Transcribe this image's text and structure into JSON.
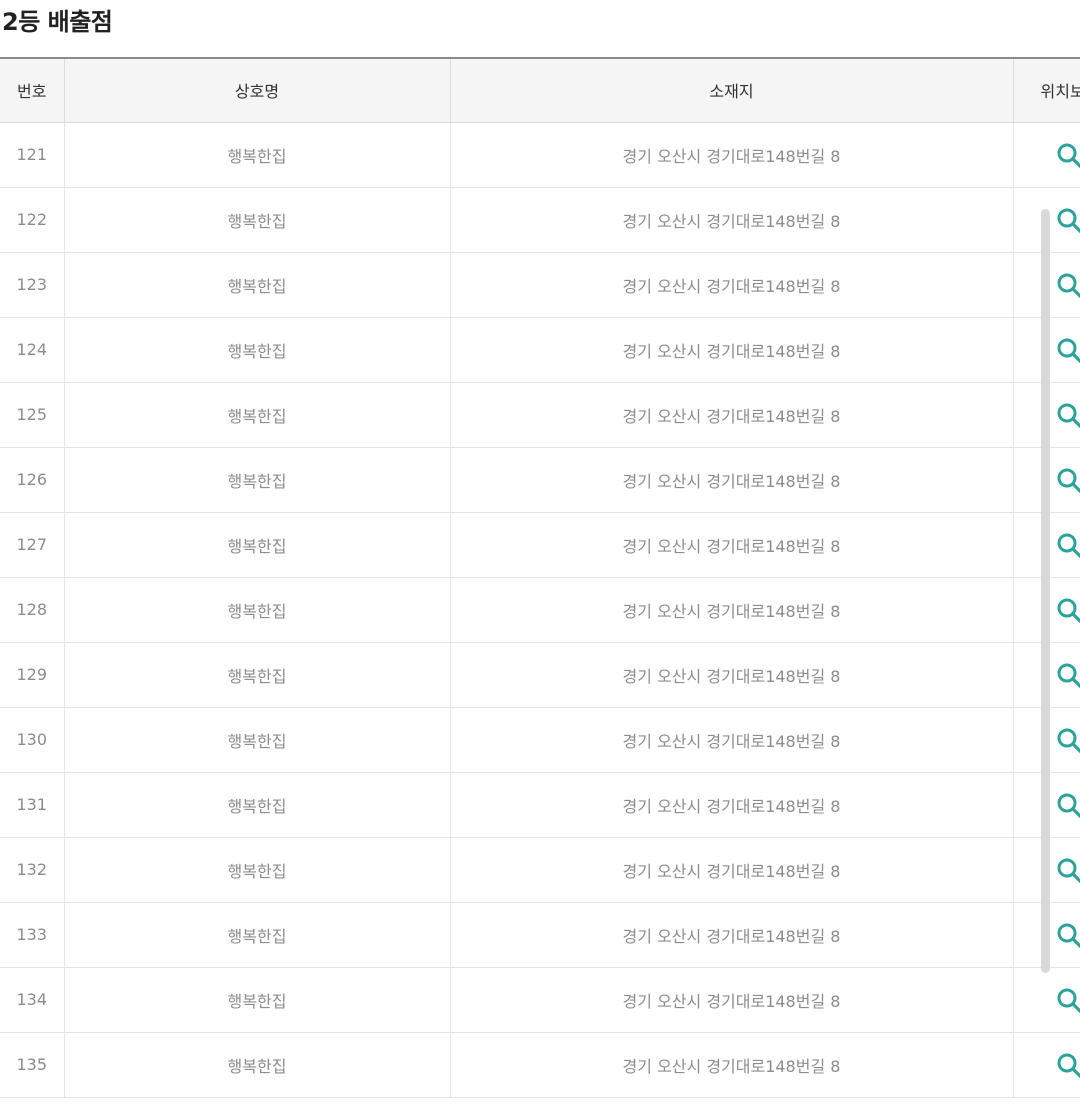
{
  "page": {
    "title": "2등 배출점"
  },
  "table": {
    "headers": {
      "number": "번호",
      "store_name": "상호명",
      "address": "소재지",
      "location": "위치보기"
    },
    "rows": [
      {
        "number": "121",
        "store_name": "행복한집",
        "address": "경기 오산시 경기대로148번길 8"
      },
      {
        "number": "122",
        "store_name": "행복한집",
        "address": "경기 오산시 경기대로148번길 8"
      },
      {
        "number": "123",
        "store_name": "행복한집",
        "address": "경기 오산시 경기대로148번길 8"
      },
      {
        "number": "124",
        "store_name": "행복한집",
        "address": "경기 오산시 경기대로148번길 8"
      },
      {
        "number": "125",
        "store_name": "행복한집",
        "address": "경기 오산시 경기대로148번길 8"
      },
      {
        "number": "126",
        "store_name": "행복한집",
        "address": "경기 오산시 경기대로148번길 8"
      },
      {
        "number": "127",
        "store_name": "행복한집",
        "address": "경기 오산시 경기대로148번길 8"
      },
      {
        "number": "128",
        "store_name": "행복한집",
        "address": "경기 오산시 경기대로148번길 8"
      },
      {
        "number": "129",
        "store_name": "행복한집",
        "address": "경기 오산시 경기대로148번길 8"
      },
      {
        "number": "130",
        "store_name": "행복한집",
        "address": "경기 오산시 경기대로148번길 8"
      },
      {
        "number": "131",
        "store_name": "행복한집",
        "address": "경기 오산시 경기대로148번길 8"
      },
      {
        "number": "132",
        "store_name": "행복한집",
        "address": "경기 오산시 경기대로148번길 8"
      },
      {
        "number": "133",
        "store_name": "행복한집",
        "address": "경기 오산시 경기대로148번길 8"
      },
      {
        "number": "134",
        "store_name": "행복한집",
        "address": "경기 오산시 경기대로148번길 8"
      },
      {
        "number": "135",
        "store_name": "행복한집",
        "address": "경기 오산시 경기대로148번길 8"
      }
    ]
  },
  "icons": {
    "location": "search-icon"
  },
  "colors": {
    "accent": "#2aa39a",
    "header_background": "#f5f5f5",
    "cell_text": "#8c8c8c"
  }
}
